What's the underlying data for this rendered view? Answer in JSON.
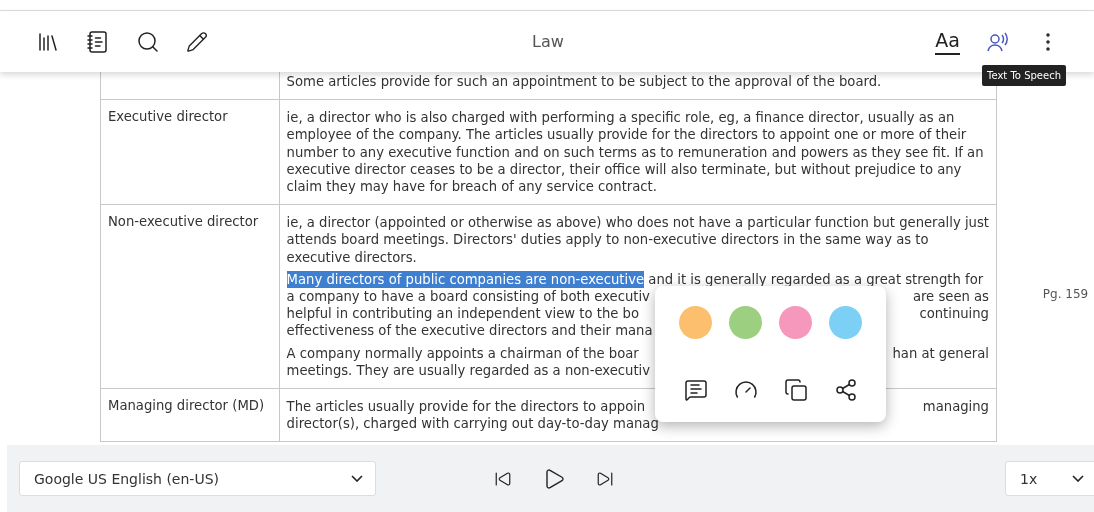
{
  "toolbar": {
    "title": "Law",
    "tooltip": "Text To Speech",
    "font_button": "Aa"
  },
  "table": {
    "rows": [
      {
        "term": "",
        "paragraphs": [
          [
            {
              "kind": "plain",
              "text": "Some articles provide for such an appointment to be subject to the approval of the board."
            }
          ]
        ]
      },
      {
        "term": "Executive director",
        "paragraphs": [
          [
            {
              "kind": "plain",
              "text": "ie, a director who is also charged with performing a specific role, eg, a finance director, usually as an"
            },
            {
              "kind": "plain",
              "text": "employee of the company. The articles usually provide for the directors to appoint one or more of their"
            },
            {
              "kind": "plain",
              "text": "number to any executive function and on such terms as to remuneration and powers as they see fit. If an"
            },
            {
              "kind": "plain",
              "text": "executive director ceases to be a director, their office will also terminate, but without prejudice to any"
            },
            {
              "kind": "plain",
              "text": "claim they may have for breach of any service contract."
            }
          ]
        ]
      },
      {
        "term": "Non-executive director",
        "paragraphs": [
          [
            {
              "kind": "plain",
              "text": "ie, a director (appointed or otherwise as above) who does not have a particular function but generally just"
            },
            {
              "kind": "plain",
              "text": "attends board meetings. Directors' duties apply to non-executive directors in the same way as to"
            },
            {
              "kind": "plain",
              "text": "executive directors."
            }
          ],
          [
            {
              "kind": "highlight",
              "highlight": "Many directors of public companies are non-executive",
              "rest": "and it is generally regarded as a great strength for"
            },
            {
              "kind": "split",
              "left": "a company to have a board consisting of both executiv",
              "right": "are seen as"
            },
            {
              "kind": "split",
              "left": "helpful in contributing an independent view to the bo",
              "right": "continuing"
            },
            {
              "kind": "split",
              "left": "effectiveness of the executive directors and their mana"
            }
          ],
          [
            {
              "kind": "split",
              "left": "A company normally appoints a chairman of the boar",
              "right": "han at general"
            },
            {
              "kind": "split",
              "left": "meetings. They are usually regarded as a non-executiv"
            }
          ]
        ]
      },
      {
        "term": "Managing director (MD)",
        "paragraphs": [
          [
            {
              "kind": "split",
              "left": "The articles usually provide for the directors to appoin",
              "right": "managing"
            },
            {
              "kind": "split",
              "left": "director(s), charged with carrying out day-to-day manag"
            }
          ]
        ]
      }
    ]
  },
  "page_number": "Pg. 159",
  "popup": {
    "colors": [
      {
        "color": "#fbbf6e"
      },
      {
        "color": "#9ccf80"
      },
      {
        "color": "#f598bb"
      },
      {
        "color": "#7dd0f5"
      }
    ]
  },
  "player": {
    "voice": "Google US English (en-US)",
    "speed": "1x"
  }
}
